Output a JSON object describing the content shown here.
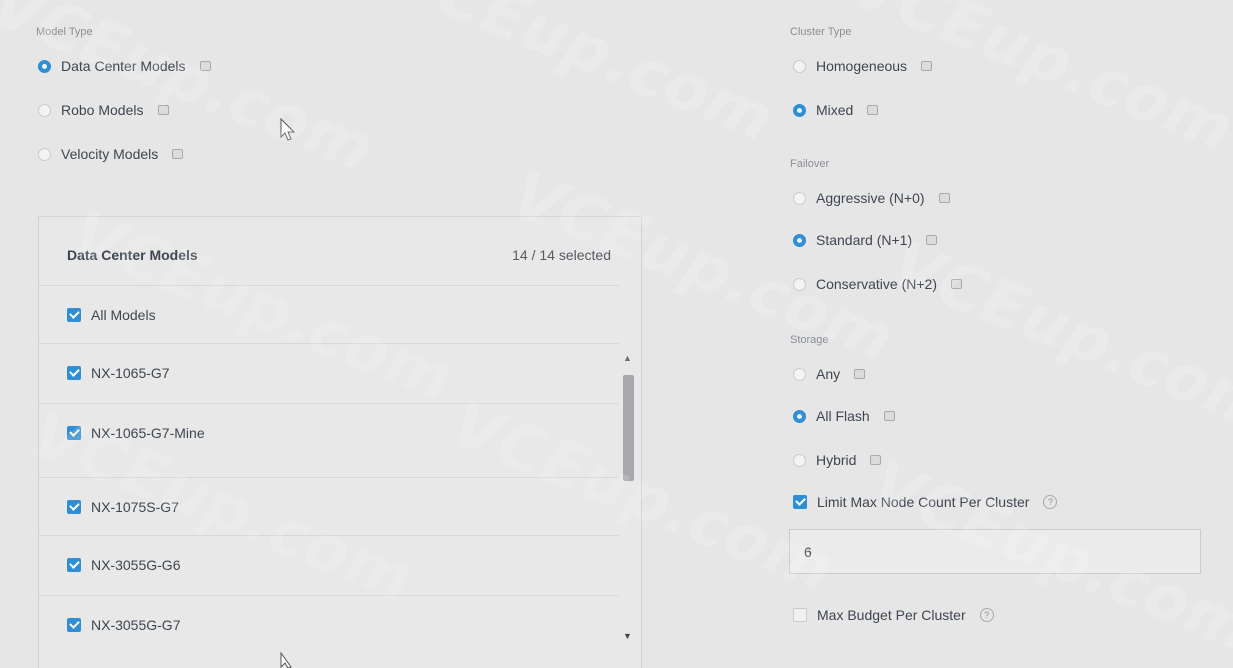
{
  "model_type": {
    "label": "Model Type",
    "options": [
      {
        "label": "Data Center Models",
        "selected": true
      },
      {
        "label": "Robo Models",
        "selected": false
      },
      {
        "label": "Velocity Models",
        "selected": false
      }
    ]
  },
  "models_panel": {
    "title": "Data Center Models",
    "count": "14 / 14 selected",
    "all_label": "All Models",
    "models": [
      "NX-1065-G7",
      "NX-1065-G7-Mine",
      "NX-1075S-G7",
      "NX-3055G-G6",
      "NX-3055G-G7"
    ]
  },
  "cluster_type": {
    "label": "Cluster Type",
    "options": [
      {
        "label": "Homogeneous",
        "selected": false
      },
      {
        "label": "Mixed",
        "selected": true
      }
    ]
  },
  "failover": {
    "label": "Failover",
    "options": [
      {
        "label": "Aggressive (N+0)",
        "selected": false
      },
      {
        "label": "Standard (N+1)",
        "selected": true
      },
      {
        "label": "Conservative (N+2)",
        "selected": false
      }
    ]
  },
  "storage": {
    "label": "Storage",
    "options": [
      {
        "label": "Any",
        "selected": false
      },
      {
        "label": "All Flash",
        "selected": true
      },
      {
        "label": "Hybrid",
        "selected": false
      }
    ]
  },
  "limits": {
    "max_node_label": "Limit Max Node Count Per Cluster",
    "max_node_checked": true,
    "max_node_value": "6",
    "max_budget_label": "Max Budget Per Cluster",
    "max_budget_checked": false
  },
  "watermark_text": "VCEup.com",
  "colors": {
    "accent": "#2e8fd6",
    "background": "#e6e6e6",
    "text": "#3f4650"
  }
}
